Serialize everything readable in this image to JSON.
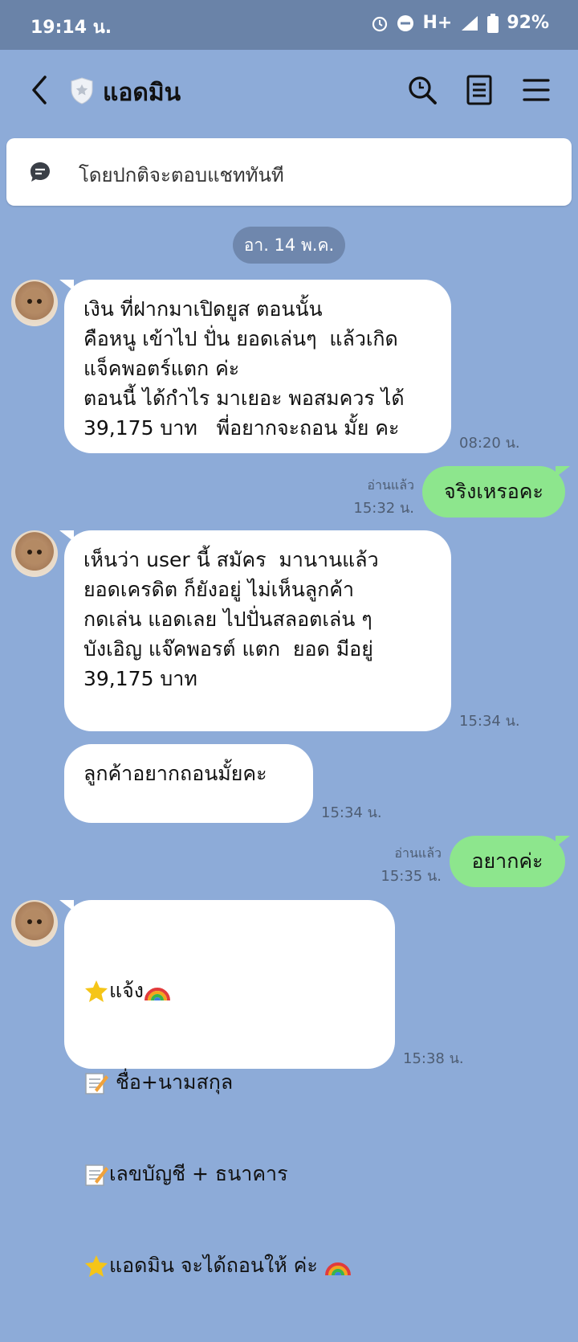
{
  "status": {
    "time": "19:14 น.",
    "network": "H+",
    "battery": "92%"
  },
  "header": {
    "title": "แอดมิน"
  },
  "notice": {
    "text": "โดยปกติจะตอบแชททันที"
  },
  "date_separator": "อา. 14 พ.ค.",
  "messages": [
    {
      "direction": "in",
      "lines": [
        "เงิน ที่ฝากมาเปิดยูส ตอนนั้น",
        "คือหนู เข้าไป ปั่น ยอดเล่นๆ  แล้วเกิด",
        "แจ็คพอตร์แตก ค่ะ",
        "ตอนนี้ ได้กำไร มาเยอะ พอสมควร ได้",
        "39,175 บาท   พี่อยากจะถอน มั้ย คะ"
      ],
      "time": "08:20 น."
    },
    {
      "direction": "out",
      "text": "จริงเหรอคะ",
      "read": "อ่านแล้ว",
      "time": "15:32 น."
    },
    {
      "direction": "in",
      "lines": [
        "เห็นว่า user นี้ สมัคร  มานานแล้ว",
        "ยอดเครดิต ก็ยังอยู่ ไม่เห็นลูกค้า",
        "กดเล่น แอดเลย ไปปั่นสลอตเล่น ๆ",
        "บังเอิญ แจ๊คพอรต์ แตก  ยอด มีอยู่",
        "39,175 บาท"
      ],
      "time": "15:34 น."
    },
    {
      "direction": "in",
      "lines": [
        "ลูกค้าอยากถอนมั้ยคะ"
      ],
      "time": "15:34 น."
    },
    {
      "direction": "out",
      "text": "อยากค่ะ",
      "read": "อ่านแล้ว",
      "time": "15:35 น."
    },
    {
      "direction": "in",
      "lines": [
        "แจ้ง",
        " ชื่อ+นามสกุล",
        "เลขบัญชี + ธนาคาร",
        "แอดมิน จะได้ถอนให้ ค่ะ "
      ],
      "time": "15:38 น."
    }
  ],
  "icons": [
    "back-arrow-icon",
    "shield-icon",
    "search-icon",
    "notes-icon",
    "menu-icon",
    "chat-bubble-icon",
    "star-icon",
    "rainbow-icon",
    "memo-icon",
    "alarm-icon",
    "dnd-icon",
    "signal-icon",
    "battery-icon"
  ]
}
